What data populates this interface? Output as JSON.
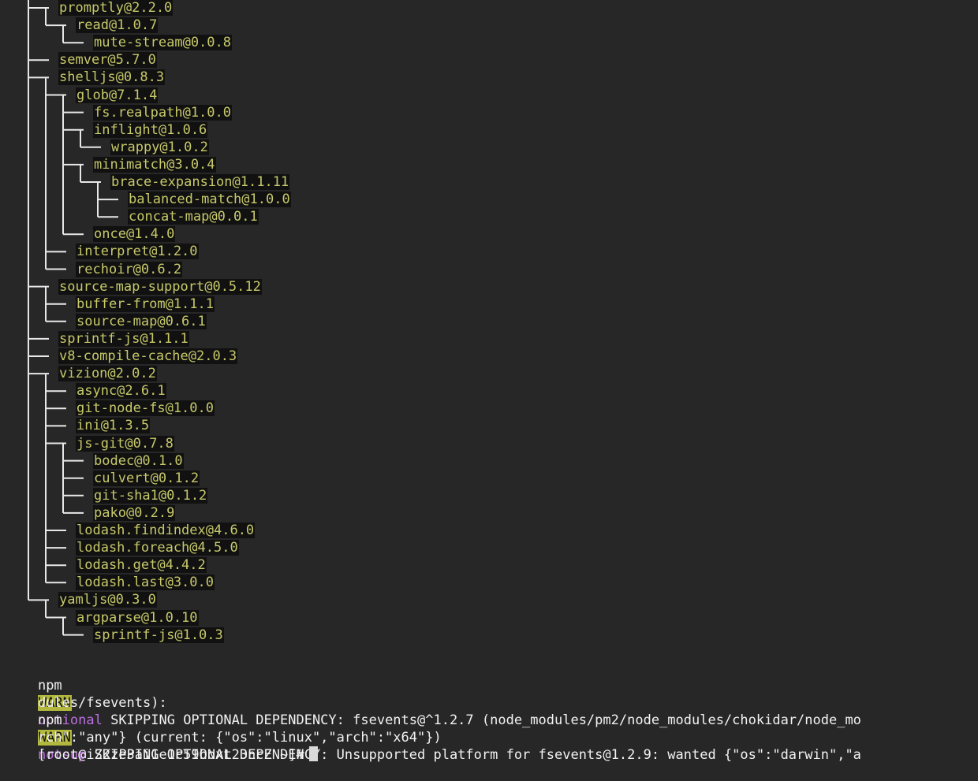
{
  "tree": [
    {
      "text": "promptly@2.2.0",
      "depth": 1
    },
    {
      "text": "read@1.0.7",
      "depth": 2
    },
    {
      "text": "mute-stream@0.0.8",
      "depth": 3
    },
    {
      "text": "semver@5.7.0",
      "depth": 1
    },
    {
      "text": "shelljs@0.8.3",
      "depth": 1
    },
    {
      "text": "glob@7.1.4",
      "depth": 2
    },
    {
      "text": "fs.realpath@1.0.0",
      "depth": 3
    },
    {
      "text": "inflight@1.0.6",
      "depth": 3
    },
    {
      "text": "wrappy@1.0.2",
      "depth": 4
    },
    {
      "text": "minimatch@3.0.4",
      "depth": 3
    },
    {
      "text": "brace-expansion@1.1.11",
      "depth": 4
    },
    {
      "text": "balanced-match@1.0.0",
      "depth": 5
    },
    {
      "text": "concat-map@0.0.1",
      "depth": 5
    },
    {
      "text": "once@1.4.0",
      "depth": 3
    },
    {
      "text": "interpret@1.2.0",
      "depth": 2
    },
    {
      "text": "rechoir@0.6.2",
      "depth": 2
    },
    {
      "text": "source-map-support@0.5.12",
      "depth": 1
    },
    {
      "text": "buffer-from@1.1.1",
      "depth": 2
    },
    {
      "text": "source-map@0.6.1",
      "depth": 2
    },
    {
      "text": "sprintf-js@1.1.1",
      "depth": 1
    },
    {
      "text": "v8-compile-cache@2.0.3",
      "depth": 1
    },
    {
      "text": "vizion@2.0.2",
      "depth": 1
    },
    {
      "text": "async@2.6.1",
      "depth": 2
    },
    {
      "text": "git-node-fs@1.0.0",
      "depth": 2
    },
    {
      "text": "ini@1.3.5",
      "depth": 2
    },
    {
      "text": "js-git@0.7.8",
      "depth": 2
    },
    {
      "text": "bodec@0.1.0",
      "depth": 3
    },
    {
      "text": "culvert@0.1.2",
      "depth": 3
    },
    {
      "text": "git-sha1@0.1.2",
      "depth": 3
    },
    {
      "text": "pako@0.2.9",
      "depth": 3
    },
    {
      "text": "lodash.findindex@4.6.0",
      "depth": 2
    },
    {
      "text": "lodash.foreach@4.5.0",
      "depth": 2
    },
    {
      "text": "lodash.get@4.4.2",
      "depth": 2
    },
    {
      "text": "lodash.last@3.0.0",
      "depth": 2
    },
    {
      "text": "yamljs@0.3.0",
      "depth": 1
    },
    {
      "text": "argparse@1.0.10",
      "depth": 2
    },
    {
      "text": "sprintf-js@1.0.3",
      "depth": 3
    }
  ],
  "log": {
    "npm": "npm",
    "warn": "WARN",
    "line1_tag": "optional",
    "line1_message": " SKIPPING OPTIONAL DEPENDENCY: fsevents@^1.2.7 (node_modules/pm2/node_modules/chokidar/node_mo",
    "line2": "dules/fsevents):",
    "line3_tag": "notsup",
    "line3_message": " SKIPPING OPTIONAL DEPENDENCY: Unsupported platform for fsevents@1.2.9: wanted {\"os\":\"darwin\",\"a",
    "line4": "rch\":\"any\"} (current: {\"os\":\"linux\",\"arch\":\"x64\"})"
  },
  "prompt": "[root@iZ2ze3ai1e1c59hoxt23ncZ ~]#",
  "colors": {
    "background": "#272727",
    "tree_text": "#c7c96a",
    "warn": "#b3b93f",
    "tag": "#bd6fe0"
  }
}
